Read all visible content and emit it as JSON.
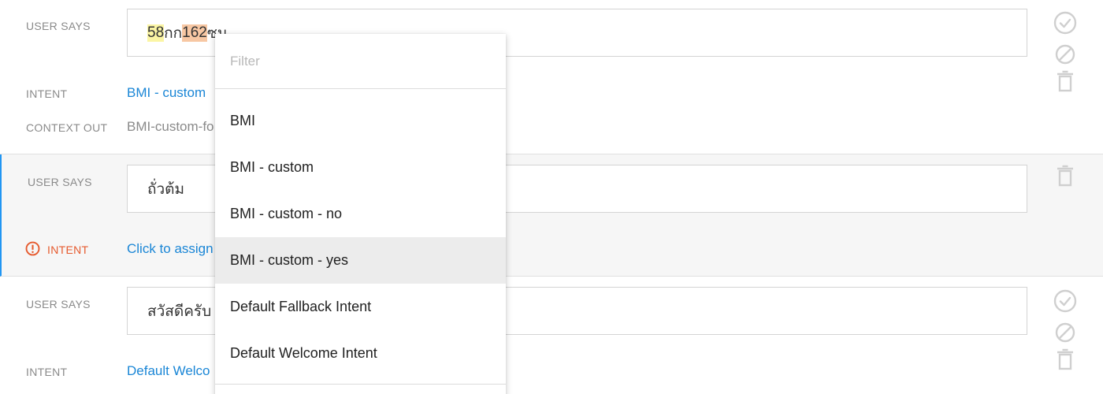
{
  "rows": [
    {
      "user_says_label": "USER SAYS",
      "phrase_parts": {
        "hl1": "58",
        "mid": "กก ",
        "hl2": "162",
        "tail": "ซม"
      },
      "intent_label": "INTENT",
      "intent_value": "BMI - custom",
      "context_out_label": "CONTEXT OUT",
      "context_out_value": "BMI-custom-fo"
    },
    {
      "user_says_label": "USER SAYS",
      "phrase": "ถั่วต้ม",
      "intent_label": "INTENT",
      "intent_value": "Click to assign"
    },
    {
      "user_says_label": "USER SAYS",
      "phrase": "สวัสดีครับ",
      "intent_label": "INTENT",
      "intent_value": "Default Welco"
    }
  ],
  "dropdown": {
    "filter_placeholder": "Filter",
    "options": [
      "BMI",
      "BMI - custom",
      "BMI - custom - no",
      "BMI - custom - yes",
      "Default Fallback Intent",
      "Default Welcome Intent"
    ],
    "highlighted_option": "BMI - custom - yes"
  },
  "colors": {
    "link": "#1a86d6",
    "warning": "#e65a2e",
    "selected_row_accent": "#2196f3",
    "icon": "#cfcfcf"
  },
  "icons": {
    "approve": "check-circle-icon",
    "ignore": "block-icon",
    "delete": "trash-icon",
    "warning": "exclamation-circle-icon"
  }
}
